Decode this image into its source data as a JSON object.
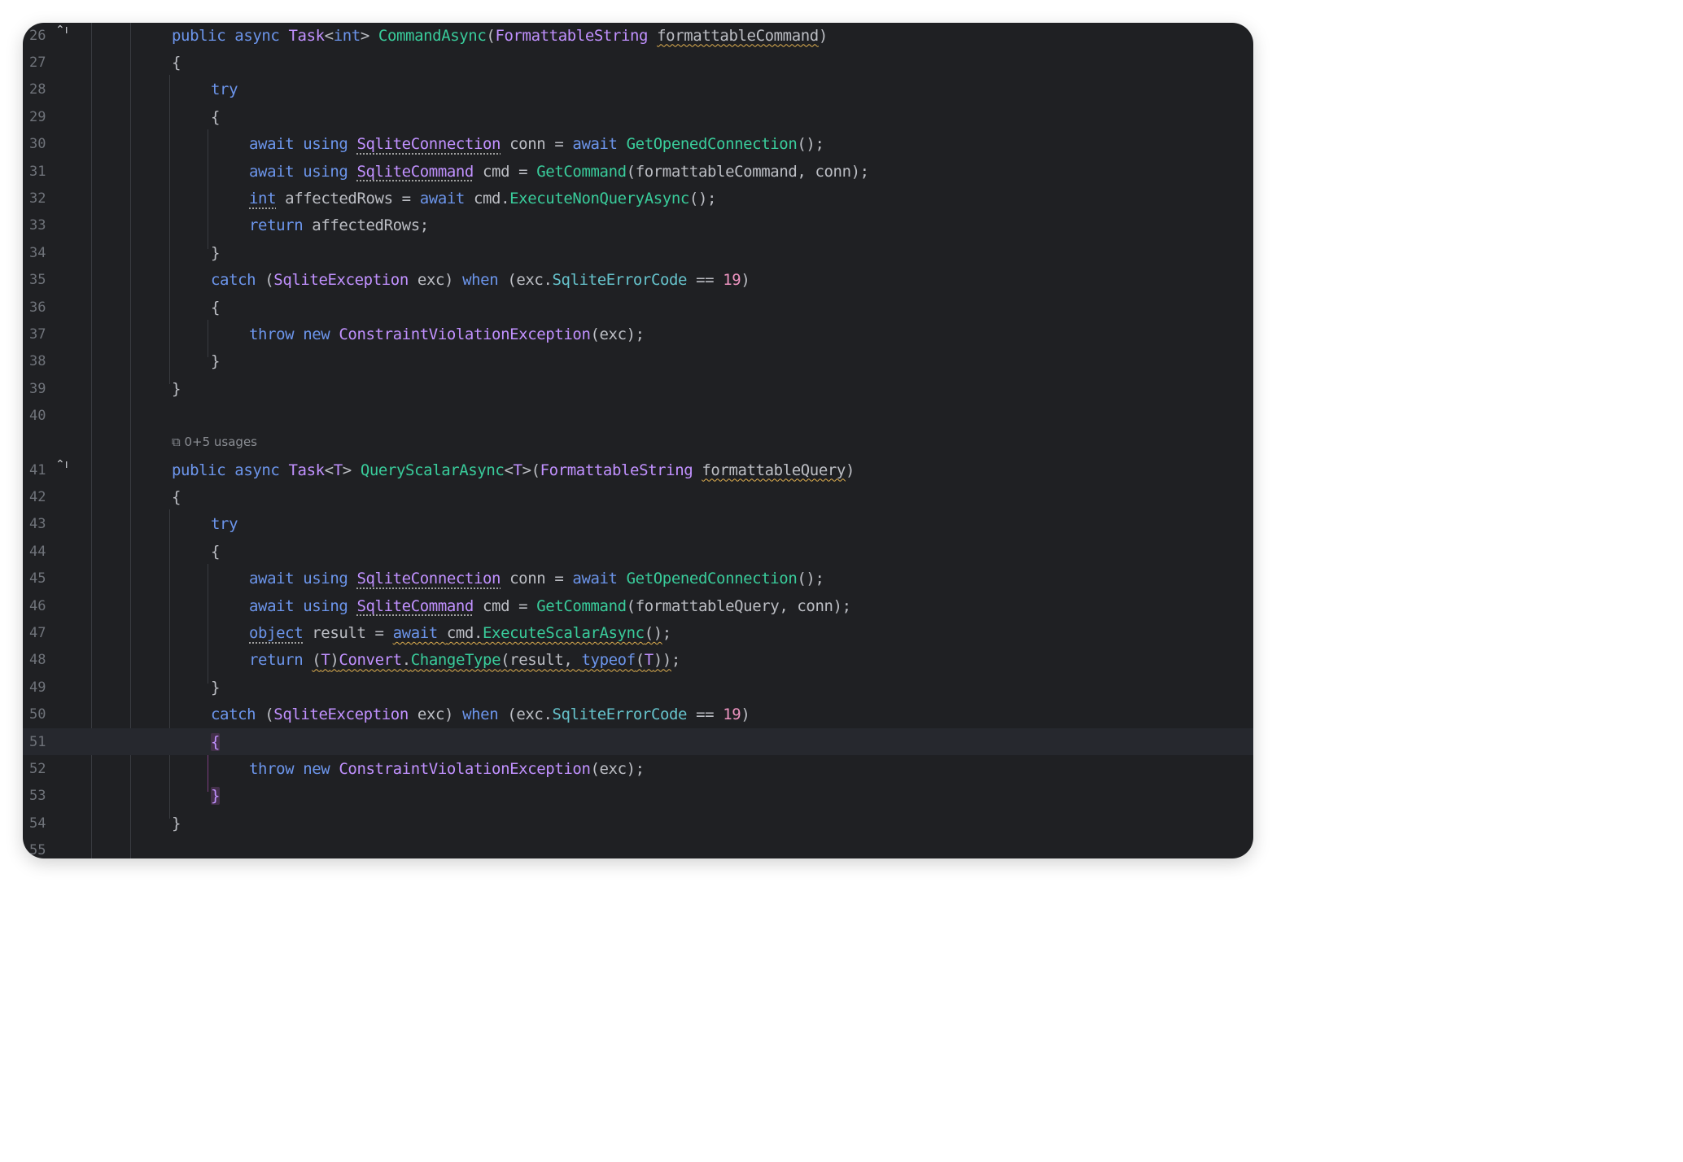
{
  "gutter": {
    "override_icon": "⌃ı",
    "usages_hint": "0+5 usages"
  },
  "lines": [
    {
      "n": "26",
      "tokens": [
        [
          "kw",
          "public "
        ],
        [
          "kw",
          "async "
        ],
        [
          "ty",
          "Task"
        ],
        [
          "pl",
          "<"
        ],
        [
          "kw",
          "int"
        ],
        [
          "pl",
          "> "
        ],
        [
          "fn",
          "CommandAsync"
        ],
        [
          "pl",
          "("
        ],
        [
          "ty",
          "FormattableString "
        ],
        [
          "pl|wavy",
          "formattableCommand"
        ],
        [
          "pl",
          ")"
        ]
      ]
    },
    {
      "n": "27",
      "tokens": [
        [
          "pl",
          "{"
        ]
      ]
    },
    {
      "n": "28",
      "tokens": [
        [
          "kw",
          "try"
        ]
      ]
    },
    {
      "n": "29",
      "tokens": [
        [
          "pl",
          "{"
        ]
      ]
    },
    {
      "n": "30",
      "tokens": [
        [
          "kw",
          "await "
        ],
        [
          "kw",
          "using "
        ],
        [
          "ty|dotted",
          "SqliteConnection"
        ],
        [
          "pl",
          " conn = "
        ],
        [
          "kw",
          "await "
        ],
        [
          "fn",
          "GetOpenedConnection"
        ],
        [
          "pl",
          "();"
        ]
      ]
    },
    {
      "n": "31",
      "tokens": [
        [
          "kw",
          "await "
        ],
        [
          "kw",
          "using "
        ],
        [
          "ty|dotted",
          "SqliteCommand"
        ],
        [
          "pl",
          " cmd = "
        ],
        [
          "fn",
          "GetCommand"
        ],
        [
          "pl",
          "(formattableCommand, conn);"
        ]
      ]
    },
    {
      "n": "32",
      "tokens": [
        [
          "kw|dotted",
          "int"
        ],
        [
          "pl",
          " affectedRows = "
        ],
        [
          "kw",
          "await "
        ],
        [
          "pl",
          "cmd."
        ],
        [
          "fn",
          "ExecuteNonQueryAsync"
        ],
        [
          "pl",
          "();"
        ]
      ]
    },
    {
      "n": "33",
      "tokens": [
        [
          "kw",
          "return "
        ],
        [
          "pl",
          "affectedRows;"
        ]
      ]
    },
    {
      "n": "34",
      "tokens": [
        [
          "pl",
          "}"
        ]
      ]
    },
    {
      "n": "35",
      "tokens": [
        [
          "kw",
          "catch "
        ],
        [
          "pl",
          "("
        ],
        [
          "ty",
          "SqliteException"
        ],
        [
          "pl",
          " exc) "
        ],
        [
          "kw",
          "when "
        ],
        [
          "pl",
          "(exc."
        ],
        [
          "pr",
          "SqliteErrorCode"
        ],
        [
          "pl",
          " == "
        ],
        [
          "num",
          "19"
        ],
        [
          "pl",
          ")"
        ]
      ]
    },
    {
      "n": "36",
      "tokens": [
        [
          "pl",
          "{"
        ]
      ]
    },
    {
      "n": "37",
      "tokens": [
        [
          "kw",
          "throw "
        ],
        [
          "kw",
          "new "
        ],
        [
          "ty",
          "ConstraintViolationException"
        ],
        [
          "pl",
          "(exc);"
        ]
      ]
    },
    {
      "n": "38",
      "tokens": [
        [
          "pl",
          "}"
        ]
      ]
    },
    {
      "n": "39",
      "tokens": [
        [
          "pl",
          "}"
        ]
      ]
    },
    {
      "n": "40",
      "tokens": []
    },
    {
      "n": "41",
      "tokens": [
        [
          "kw",
          "public "
        ],
        [
          "kw",
          "async "
        ],
        [
          "ty",
          "Task"
        ],
        [
          "pl",
          "<"
        ],
        [
          "ty",
          "T"
        ],
        [
          "pl",
          "> "
        ],
        [
          "fn",
          "QueryScalarAsync"
        ],
        [
          "pl",
          "<"
        ],
        [
          "ty",
          "T"
        ],
        [
          "pl",
          ">("
        ],
        [
          "ty",
          "FormattableString "
        ],
        [
          "pl|wavy",
          "formattableQuery"
        ],
        [
          "pl",
          ")"
        ]
      ]
    },
    {
      "n": "42",
      "tokens": [
        [
          "pl",
          "{"
        ]
      ]
    },
    {
      "n": "43",
      "tokens": [
        [
          "kw",
          "try"
        ]
      ]
    },
    {
      "n": "44",
      "tokens": [
        [
          "pl",
          "{"
        ]
      ]
    },
    {
      "n": "45",
      "tokens": [
        [
          "kw",
          "await "
        ],
        [
          "kw",
          "using "
        ],
        [
          "ty|dotted",
          "SqliteConnection"
        ],
        [
          "pl",
          " conn = "
        ],
        [
          "kw",
          "await "
        ],
        [
          "fn",
          "GetOpenedConnection"
        ],
        [
          "pl",
          "();"
        ]
      ]
    },
    {
      "n": "46",
      "tokens": [
        [
          "kw",
          "await "
        ],
        [
          "kw",
          "using "
        ],
        [
          "ty|dotted",
          "SqliteCommand"
        ],
        [
          "pl",
          " cmd = "
        ],
        [
          "fn",
          "GetCommand"
        ],
        [
          "pl",
          "(formattableQuery, conn);"
        ]
      ]
    },
    {
      "n": "47",
      "tokens": [
        [
          "kw|dotted",
          "object"
        ],
        [
          "pl",
          " result = "
        ],
        [
          "kw|wavy",
          "await "
        ],
        [
          "pl|wavy",
          "cmd."
        ],
        [
          "fn|wavy",
          "ExecuteScalarAsync"
        ],
        [
          "pl|wavy",
          "()"
        ],
        [
          "pl",
          ";"
        ]
      ]
    },
    {
      "n": "48",
      "tokens": [
        [
          "kw",
          "return "
        ],
        [
          "pl|wavy",
          "("
        ],
        [
          "ty|wavy",
          "T"
        ],
        [
          "pl|wavy",
          ")"
        ],
        [
          "ty|wavy",
          "Convert"
        ],
        [
          "pl|wavy",
          "."
        ],
        [
          "fn|wavy",
          "ChangeType"
        ],
        [
          "pl|wavy",
          "(result, "
        ],
        [
          "kw|wavy",
          "typeof"
        ],
        [
          "pl|wavy",
          "("
        ],
        [
          "ty|wavy",
          "T"
        ],
        [
          "pl|wavy",
          "))"
        ],
        [
          "pl",
          ";"
        ]
      ]
    },
    {
      "n": "49",
      "tokens": [
        [
          "pl",
          "}"
        ]
      ]
    },
    {
      "n": "50",
      "tokens": [
        [
          "kw",
          "catch "
        ],
        [
          "pl",
          "("
        ],
        [
          "ty",
          "SqliteException"
        ],
        [
          "pl",
          " exc) "
        ],
        [
          "kw",
          "when "
        ],
        [
          "pl",
          "(exc."
        ],
        [
          "pr",
          "SqliteErrorCode"
        ],
        [
          "pl",
          " == "
        ],
        [
          "num",
          "19"
        ],
        [
          "pl",
          ")"
        ]
      ]
    },
    {
      "n": "51",
      "tokens": [
        [
          "ty|brace",
          "{"
        ]
      ]
    },
    {
      "n": "52",
      "tokens": [
        [
          "kw",
          "throw "
        ],
        [
          "kw",
          "new "
        ],
        [
          "ty",
          "ConstraintViolationException"
        ],
        [
          "pl",
          "(exc);"
        ]
      ]
    },
    {
      "n": "53",
      "tokens": [
        [
          "ty|brace",
          "}"
        ]
      ]
    },
    {
      "n": "54",
      "tokens": [
        [
          "pl",
          "}"
        ]
      ]
    },
    {
      "n": "55",
      "tokens": []
    }
  ]
}
